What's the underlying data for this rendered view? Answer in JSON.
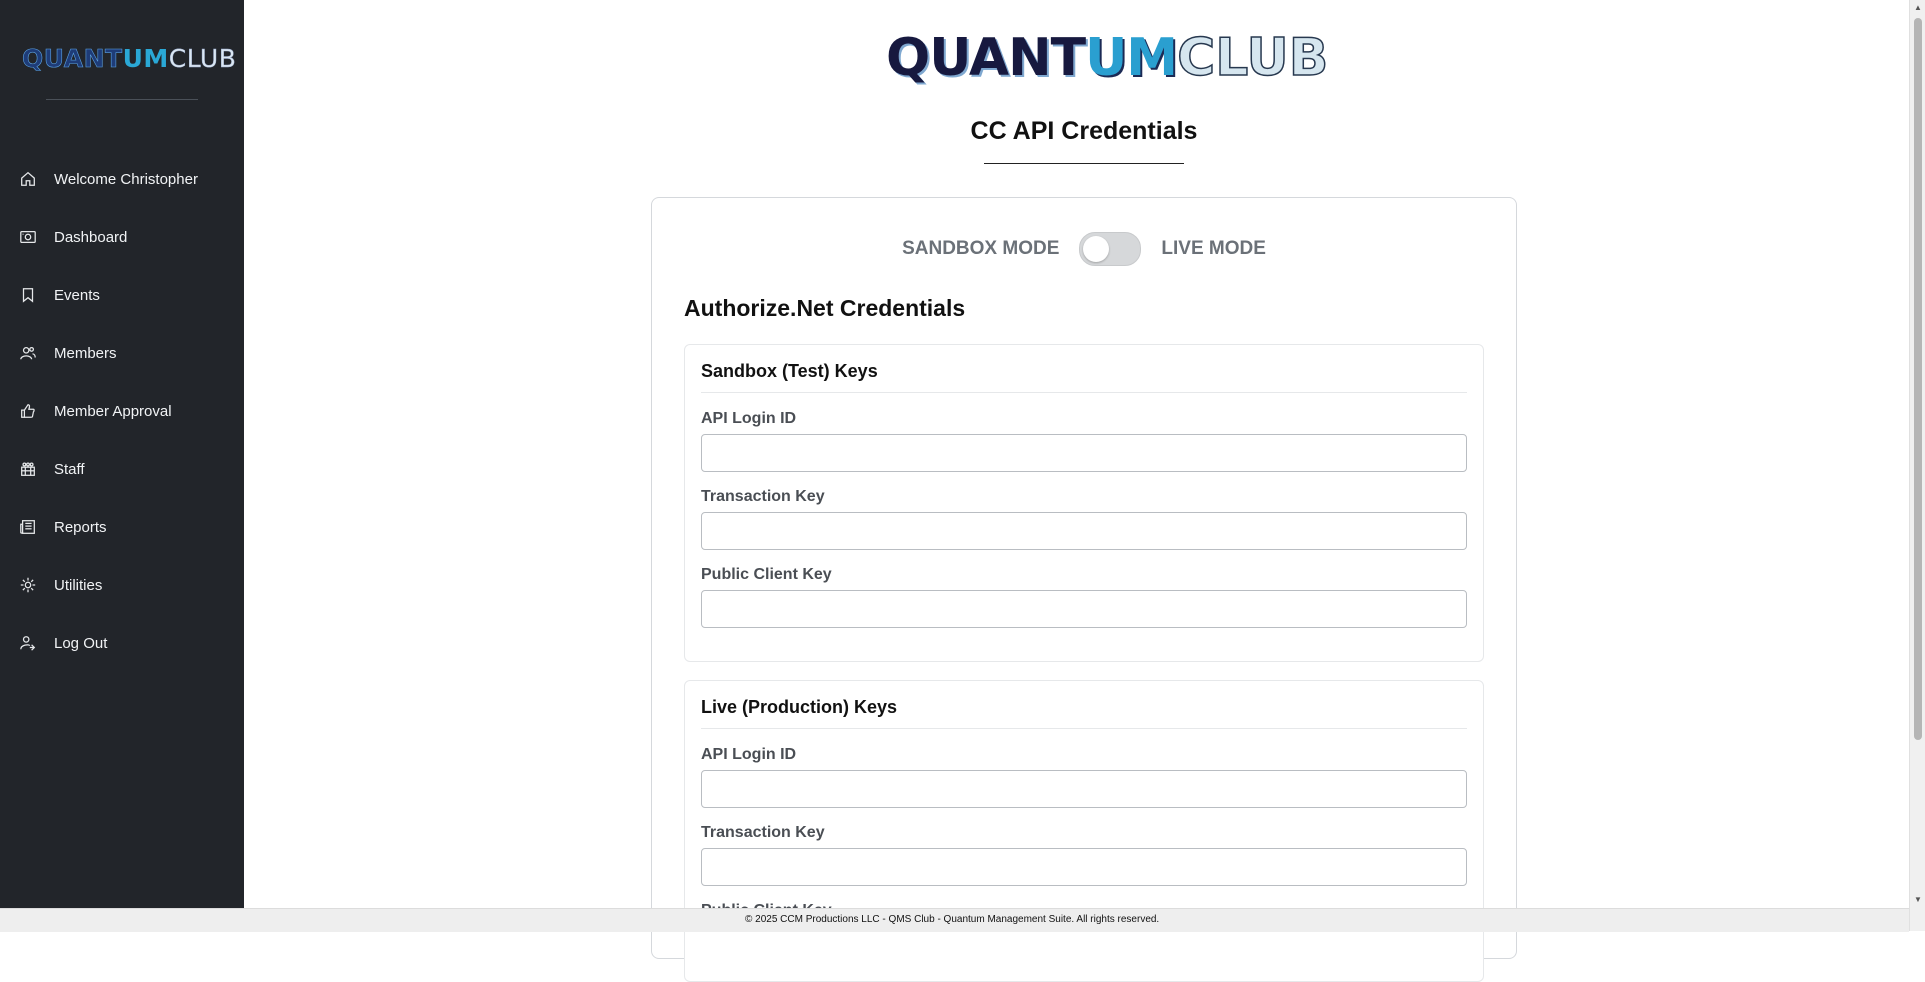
{
  "sidebar": {
    "logo": {
      "q": "QUANT",
      "q2": "UM",
      "c": "CLUB"
    },
    "items": [
      {
        "label": "Welcome Christopher",
        "icon": "home-icon"
      },
      {
        "label": "Dashboard",
        "icon": "dashboard-icon"
      },
      {
        "label": "Events",
        "icon": "bookmark-icon"
      },
      {
        "label": "Members",
        "icon": "users-icon"
      },
      {
        "label": "Member Approval",
        "icon": "thumbs-up-icon"
      },
      {
        "label": "Staff",
        "icon": "staff-icon"
      },
      {
        "label": "Reports",
        "icon": "newspaper-icon"
      },
      {
        "label": "Utilities",
        "icon": "gear-icon"
      },
      {
        "label": "Log Out",
        "icon": "logout-icon"
      }
    ]
  },
  "header": {
    "brand": {
      "q": "QUANT",
      "q2": "UM",
      "c": "CLUB"
    },
    "title": "CC API Credentials"
  },
  "mode": {
    "sandbox_label": "SANDBOX MODE",
    "live_label": "LIVE MODE",
    "live_enabled": false
  },
  "section": {
    "title": "Authorize.Net Credentials"
  },
  "sandbox": {
    "title": "Sandbox (Test) Keys",
    "api_login_label": "API Login ID",
    "api_login_value": "",
    "transaction_key_label": "Transaction Key",
    "transaction_key_value": "",
    "public_client_key_label": "Public Client Key",
    "public_client_key_value": ""
  },
  "live": {
    "title": "Live (Production) Keys",
    "api_login_label": "API Login ID",
    "api_login_value": "",
    "transaction_key_label": "Transaction Key",
    "transaction_key_value": "",
    "public_client_key_label": "Public Client Key"
  },
  "footer": {
    "text": "© 2025 CCM Productions LLC - QMS Club - Quantum Management Suite. All rights reserved."
  }
}
